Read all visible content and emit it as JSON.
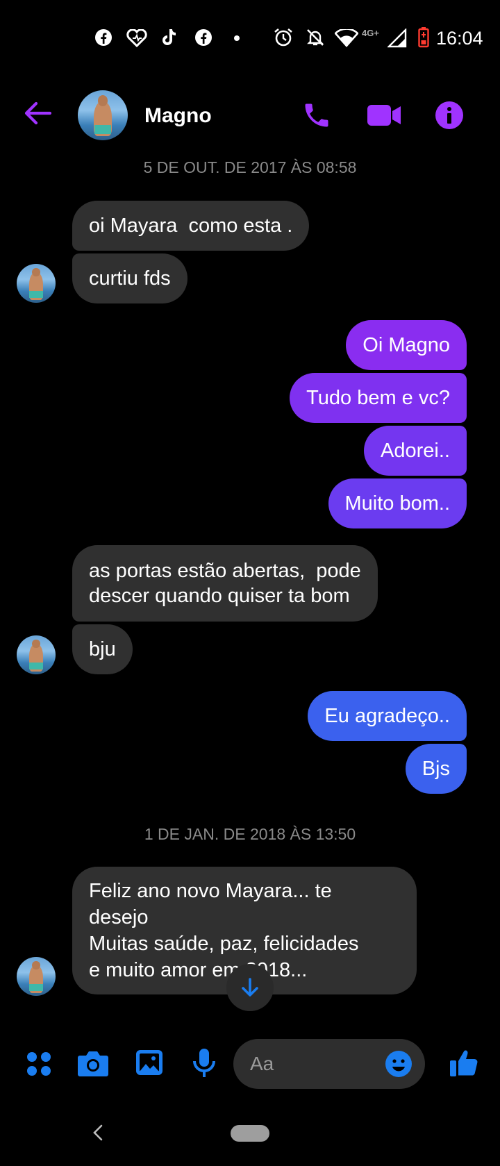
{
  "status_bar": {
    "time": "16:04",
    "network": "4G+",
    "notification_icons": [
      "facebook-icon",
      "heart-icon",
      "tiktok-icon",
      "facebook-icon",
      "dot-icon"
    ],
    "system_icons": [
      "alarm-icon",
      "mute-icon",
      "wifi-icon",
      "signal-icon",
      "battery-icon"
    ]
  },
  "header": {
    "contact_name": "Magno",
    "actions": [
      "back-arrow-icon",
      "phone-icon",
      "video-icon",
      "info-icon"
    ],
    "accent": "#a033ff"
  },
  "messages": {
    "sep1": "5 DE OUT. DE 2017 ÀS 08:58",
    "m1": "oi Mayara  como esta .",
    "m2": "curtiu fds",
    "m3": "Oi Magno",
    "m4": "Tudo bem e vc?",
    "m5": "Adorei..",
    "m6": "Muito bom..",
    "m7a": "as portas estão abertas,  pode",
    "m7b": "descer quando quiser ta bom",
    "m8": "bju",
    "m9": "Eu agradeço..",
    "m10": "Bjs",
    "sep2": "1 DE JAN. DE 2018 ÀS 13:50",
    "m11a": "Feliz ano novo Mayara... te",
    "m11b": "desejo",
    "m11c": "Muitas saúde, paz, felicidades",
    "m11d": "e muito amor em 2018..."
  },
  "composer": {
    "placeholder": "Aa",
    "tools": [
      "apps-icon",
      "camera-icon",
      "gallery-icon",
      "mic-icon",
      "emoji-icon",
      "thumbs-up-icon"
    ],
    "accent": "#1a7df0"
  },
  "colors": {
    "incoming_bubble": "#303030",
    "outgoing_purple_top": "#8a2df0",
    "outgoing_purple_bottom": "#6b3cf0",
    "outgoing_blue": "#3b61ee"
  }
}
